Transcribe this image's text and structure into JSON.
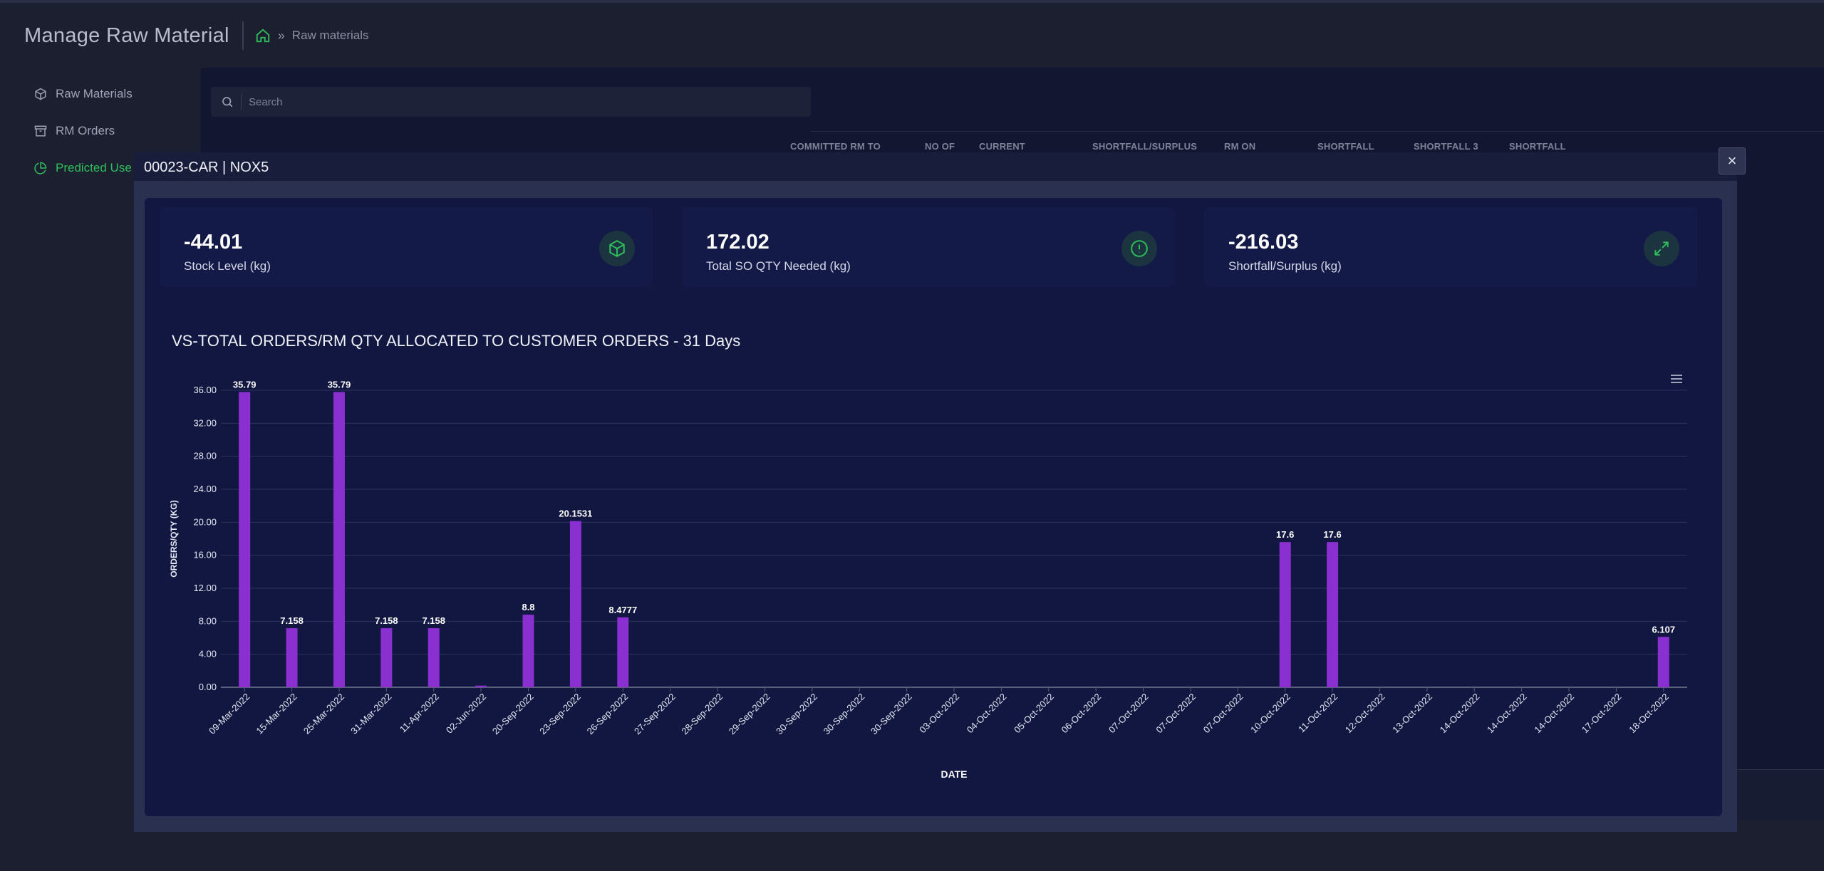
{
  "page": {
    "title": "Manage Raw Material",
    "breadcrumb": {
      "home_icon": "home-icon",
      "separator": "»",
      "current": "Raw materials"
    }
  },
  "sidebar": {
    "items": [
      {
        "label": "Raw Materials",
        "icon": "cube-icon",
        "active": false
      },
      {
        "label": "RM Orders",
        "icon": "archive-icon",
        "active": false
      },
      {
        "label": "Predicted Use",
        "icon": "pie-chart-icon",
        "active": true
      }
    ]
  },
  "search": {
    "placeholder": "Search"
  },
  "table_headers": [
    "COMMITTED RM TO",
    "NO OF",
    "CURRENT",
    "SHORTFALL/SURPLUS",
    "RM ON",
    "SHORTFALL",
    "SHORTFALL 3",
    "SHORTFALL"
  ],
  "modal": {
    "title": "00023-CAR | NOX5",
    "close_label": "×",
    "stats": [
      {
        "value": "-44.01",
        "label": "Stock Level (kg)",
        "icon": "cube-icon"
      },
      {
        "value": "172.02",
        "label": "Total SO QTY Needed (kg)",
        "icon": "alert-circle-icon"
      },
      {
        "value": "-216.03",
        "label": "Shortfall/Surplus (kg)",
        "icon": "expand-icon"
      }
    ]
  },
  "colors": {
    "accent_green": "#2fbf5b",
    "bar": "#8a2fd0",
    "modal_bg": "#111741"
  },
  "chart_data": {
    "type": "bar",
    "title": "VS-TOTAL ORDERS/RM QTY ALLOCATED TO CUSTOMER ORDERS - 31 Days",
    "xlabel": "DATE",
    "ylabel": "ORDERS/QTY (KG)",
    "ylim": [
      0,
      36
    ],
    "yticks": [
      "0.00",
      "4.00",
      "8.00",
      "12.00",
      "16.00",
      "20.00",
      "24.00",
      "28.00",
      "32.00",
      "36.00"
    ],
    "grid": true,
    "categories": [
      "09-Mar-2022",
      "15-Mar-2022",
      "25-Mar-2022",
      "31-Mar-2022",
      "11-Apr-2022",
      "02-Jun-2022",
      "20-Sep-2022",
      "23-Sep-2022",
      "26-Sep-2022",
      "27-Sep-2022",
      "28-Sep-2022",
      "29-Sep-2022",
      "30-Sep-2022",
      "30-Sep-2022",
      "30-Sep-2022",
      "03-Oct-2022",
      "04-Oct-2022",
      "05-Oct-2022",
      "06-Oct-2022",
      "07-Oct-2022",
      "07-Oct-2022",
      "07-Oct-2022",
      "10-Oct-2022",
      "11-Oct-2022",
      "12-Oct-2022",
      "13-Oct-2022",
      "14-Oct-2022",
      "14-Oct-2022",
      "14-Oct-2022",
      "17-Oct-2022",
      "18-Oct-2022"
    ],
    "values": [
      35.79,
      7.158,
      35.79,
      7.158,
      7.158,
      0.2,
      8.8,
      20.1531,
      8.4777,
      0,
      0,
      0,
      0,
      0,
      0,
      0,
      0,
      0,
      0,
      0,
      0,
      0,
      17.6,
      17.6,
      0,
      0,
      0,
      0,
      0,
      0,
      6.107
    ],
    "data_labels": [
      "35.79",
      "7.158",
      "35.79",
      "7.158",
      "7.158",
      "",
      "8.8",
      "20.1531",
      "8.4777",
      "",
      "",
      "",
      "",
      "",
      "",
      "",
      "",
      "",
      "",
      "",
      "",
      "",
      "17.6",
      "17.6",
      "",
      "",
      "",
      "",
      "",
      "",
      "6.107"
    ]
  }
}
